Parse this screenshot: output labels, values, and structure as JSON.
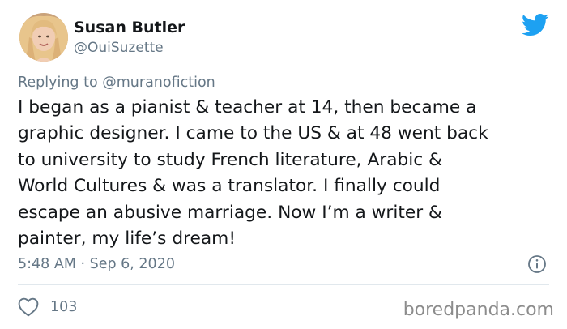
{
  "user": {
    "display_name": "Susan Butler",
    "handle": "@OuiSuzette"
  },
  "reply": {
    "prefix": "Replying to",
    "mention": "@muranofiction"
  },
  "tweet": {
    "lines": [
      "I began as a pianist & teacher at 14, then became a",
      "graphic designer. I came to the US & at 48 went back",
      "to university to study French literature, Arabic &",
      "World Cultures & was a translator. I finally could",
      "escape an abusive marriage. Now I’m a writer &",
      "painter, my life’s dream!"
    ],
    "timestamp": "5:48 AM · Sep 6, 2020",
    "likes": "103"
  },
  "watermark": "boredpanda.com",
  "icons": {
    "brand": "twitter-bird-icon",
    "info": "info-icon",
    "like": "heart-icon"
  },
  "colors": {
    "twitter_blue": "#1da1f2",
    "text": "#14171a",
    "muted": "#657786",
    "divider": "#e1e8ed"
  }
}
